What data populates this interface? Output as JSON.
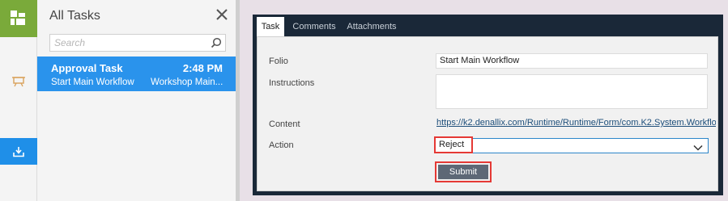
{
  "rail": {
    "logo_icon": "apps-grid-icon",
    "board_icon": "easel-icon",
    "download_icon": "download-icon",
    "colors": {
      "logo_bg": "#7aaa3a",
      "active_bg": "#1f8fe8"
    }
  },
  "tasklist": {
    "title": "All Tasks",
    "close_icon": "close-icon",
    "search": {
      "placeholder": "Search",
      "value": ""
    },
    "items": [
      {
        "title": "Approval Task",
        "time": "2:48 PM",
        "subtitle": "Start Main Workflow",
        "folio": "Workshop Main..."
      }
    ]
  },
  "form": {
    "tabs": [
      {
        "label": "Task",
        "active": true
      },
      {
        "label": "Comments",
        "active": false
      },
      {
        "label": "Attachments",
        "active": false
      }
    ],
    "folio": {
      "label": "Folio",
      "value": "Start Main Workflow"
    },
    "instructions": {
      "label": "Instructions",
      "value": ""
    },
    "content": {
      "label": "Content",
      "link": "https://k2.denallix.com/Runtime/Runtime/Form/com.K2.System.Workflow.Form."
    },
    "action": {
      "label": "Action",
      "selected": "Reject"
    },
    "submit_label": "Submit"
  }
}
